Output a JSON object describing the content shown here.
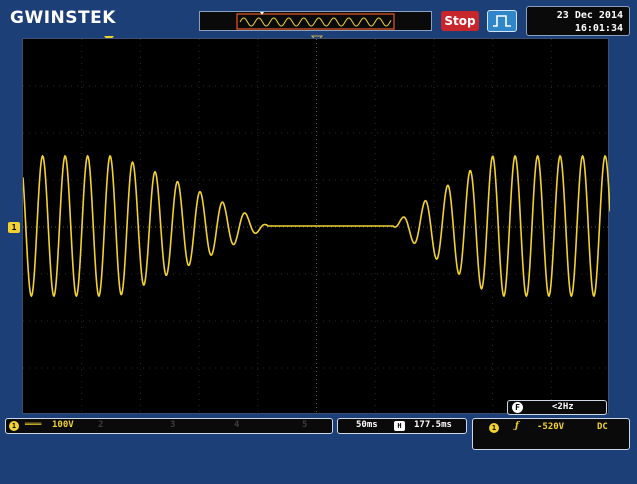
{
  "header": {
    "brand": "GWINSTEK",
    "run_state": "Stop",
    "date": "23 Dec 2014",
    "time": "16:01:34"
  },
  "channel1": {
    "marker_label": "1",
    "coupling_symbol": "═══",
    "scale": "100V",
    "disabled_channels": [
      "2",
      "3",
      "4",
      "5"
    ],
    "color": "#f2d231"
  },
  "timebase": {
    "scale": "50ms",
    "horizontal_icon": "H",
    "position": "177.5ms"
  },
  "trigger": {
    "source": "1",
    "slope_symbol": "ƒ",
    "level": "-520V",
    "coupling": "DC"
  },
  "frequency": {
    "icon": "F",
    "value": "<2Hz"
  },
  "colors": {
    "background": "#1d3f78",
    "screen": "#000000",
    "trace": "#f2d231",
    "stop": "#c7262c",
    "accent": "#2f86c8"
  },
  "icons": {
    "trigger_type": "edge-trigger-icon",
    "horizontal": "horizontal-position-icon",
    "frequency": "frequency-counter-icon"
  }
}
